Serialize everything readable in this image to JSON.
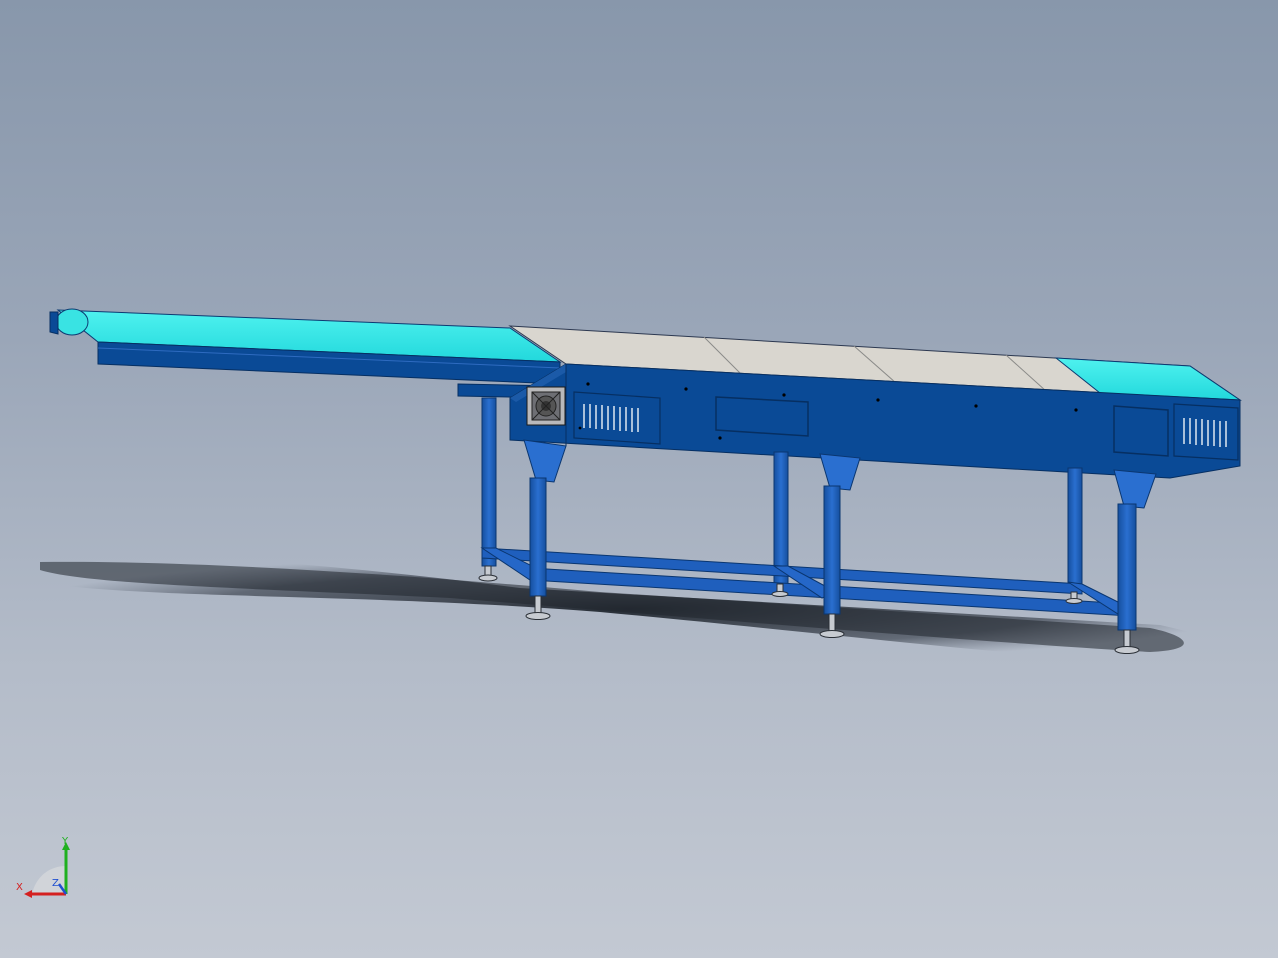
{
  "viewport": {
    "background_top": "#8897ab",
    "background_bottom": "#c3c9d3"
  },
  "colors": {
    "frame_blue": "#0a4a96",
    "leg_blue": "#1f5fbd",
    "belt_cyan": "#2fe6e6",
    "oven_cover": "#d7d5cf",
    "shadow": "#2e3540"
  },
  "triad": {
    "x_label": "X",
    "y_label": "Y",
    "z_label": "Z",
    "x_color": "#d42020",
    "y_color": "#1fb01f",
    "z_color": "#2050d0"
  }
}
